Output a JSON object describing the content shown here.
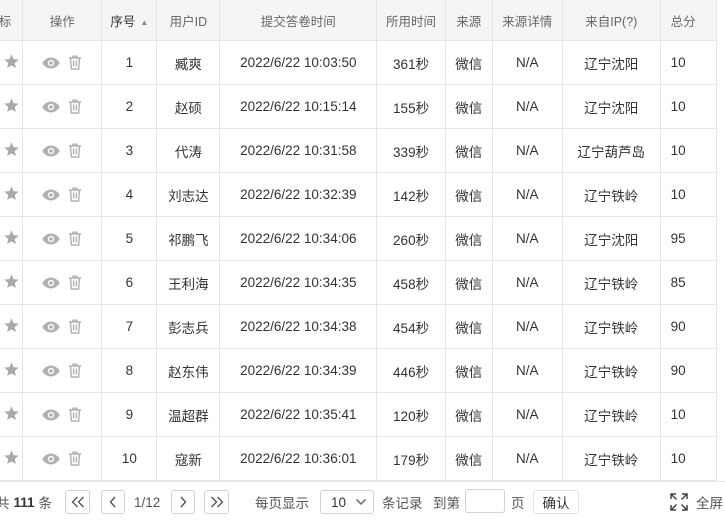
{
  "table": {
    "headers": {
      "mark": "标",
      "ops": "操作",
      "seq": "序号",
      "user": "用户ID",
      "time": "提交答卷时间",
      "duration": "所用时间",
      "source": "来源",
      "source_detail": "来源详情",
      "ip": "来自IP(?)",
      "total": "总分"
    },
    "sort_indicator": "▲",
    "rows": [
      {
        "seq": "1",
        "user": "臧爽",
        "time": "2022/6/22 10:03:50",
        "duration": "361秒",
        "source": "微信",
        "source_detail": "N/A",
        "ip": "辽宁沈阳",
        "total": "10"
      },
      {
        "seq": "2",
        "user": "赵硕",
        "time": "2022/6/22 10:15:14",
        "duration": "155秒",
        "source": "微信",
        "source_detail": "N/A",
        "ip": "辽宁沈阳",
        "total": "10"
      },
      {
        "seq": "3",
        "user": "代涛",
        "time": "2022/6/22 10:31:58",
        "duration": "339秒",
        "source": "微信",
        "source_detail": "N/A",
        "ip": "辽宁葫芦岛",
        "total": "10"
      },
      {
        "seq": "4",
        "user": "刘志达",
        "time": "2022/6/22 10:32:39",
        "duration": "142秒",
        "source": "微信",
        "source_detail": "N/A",
        "ip": "辽宁铁岭",
        "total": "10"
      },
      {
        "seq": "5",
        "user": "祁鹏飞",
        "time": "2022/6/22 10:34:06",
        "duration": "260秒",
        "source": "微信",
        "source_detail": "N/A",
        "ip": "辽宁沈阳",
        "total": "95"
      },
      {
        "seq": "6",
        "user": "王利海",
        "time": "2022/6/22 10:34:35",
        "duration": "458秒",
        "source": "微信",
        "source_detail": "N/A",
        "ip": "辽宁铁岭",
        "total": "85"
      },
      {
        "seq": "7",
        "user": "彭志兵",
        "time": "2022/6/22 10:34:38",
        "duration": "454秒",
        "source": "微信",
        "source_detail": "N/A",
        "ip": "辽宁铁岭",
        "total": "90"
      },
      {
        "seq": "8",
        "user": "赵东伟",
        "time": "2022/6/22 10:34:39",
        "duration": "446秒",
        "source": "微信",
        "source_detail": "N/A",
        "ip": "辽宁铁岭",
        "total": "90"
      },
      {
        "seq": "9",
        "user": "温超群",
        "time": "2022/6/22 10:35:41",
        "duration": "120秒",
        "source": "微信",
        "source_detail": "N/A",
        "ip": "辽宁铁岭",
        "total": "10"
      },
      {
        "seq": "10",
        "user": "寇新",
        "time": "2022/6/22 10:36:01",
        "duration": "179秒",
        "source": "微信",
        "source_detail": "N/A",
        "ip": "辽宁铁岭",
        "total": "10"
      }
    ]
  },
  "footer": {
    "total_prefix": "共",
    "total_count": "111",
    "total_suffix": "条",
    "page_indicator": "1/12",
    "per_page_label": "每页显示",
    "per_page_value": "10",
    "records_label": "条记录",
    "jump_label": "到第",
    "jump_value": "",
    "page_label": "页",
    "confirm_label": "确认",
    "fullscreen_label": "全屏"
  },
  "icons": {
    "star": "star-icon",
    "view": "eye-icon",
    "delete": "trash-icon",
    "first": "double-chevron-left-icon",
    "prev": "chevron-left-icon",
    "next": "chevron-right-icon",
    "last": "double-chevron-right-icon",
    "dropdown": "chevron-down-icon",
    "fullscreen": "expand-icon"
  },
  "colors": {
    "icon_gray": "#a8a8a8",
    "header_bg": "#f5f5f5",
    "border": "#e6e6e6"
  }
}
